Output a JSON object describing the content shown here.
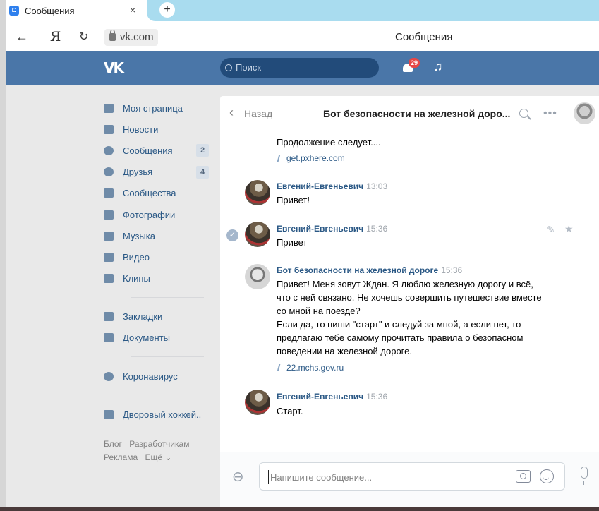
{
  "browser": {
    "tab_title": "Сообщения",
    "tab_close": "×",
    "new_tab": "+",
    "nav_back": "←",
    "nav_ya": "Я",
    "nav_reload": "↻",
    "url": "vk.com",
    "page_title": "Сообщения"
  },
  "vk_header": {
    "logo": "VK",
    "search_placeholder": "Поиск",
    "notifications_count": "29",
    "music_icon": "♫"
  },
  "sidebar": {
    "items": [
      {
        "label": "Моя страница",
        "icon": "home-icon",
        "count": ""
      },
      {
        "label": "Новости",
        "icon": "news-icon",
        "count": ""
      },
      {
        "label": "Сообщения",
        "icon": "messages-icon",
        "count": "2"
      },
      {
        "label": "Друзья",
        "icon": "friends-icon",
        "count": "4"
      },
      {
        "label": "Сообщества",
        "icon": "communities-icon",
        "count": ""
      },
      {
        "label": "Фотографии",
        "icon": "photos-icon",
        "count": ""
      },
      {
        "label": "Музыка",
        "icon": "music-icon",
        "count": ""
      },
      {
        "label": "Видео",
        "icon": "video-icon",
        "count": ""
      },
      {
        "label": "Клипы",
        "icon": "clips-icon",
        "count": ""
      },
      {
        "label": "Закладки",
        "icon": "bookmarks-icon",
        "count": ""
      },
      {
        "label": "Документы",
        "icon": "documents-icon",
        "count": ""
      },
      {
        "label": "Коронавирус",
        "icon": "coronavirus-icon",
        "count": ""
      },
      {
        "label": "Дворовый хоккей..",
        "icon": "group-icon",
        "count": ""
      }
    ],
    "footer": [
      "Блог",
      "Разработчикам",
      "Реклама",
      "Ещё ⌄"
    ]
  },
  "chat": {
    "back_label": "Назад",
    "back_chevron": "‹",
    "title": "Бот безопасности на железной доро...",
    "more": "•••",
    "messages": [
      {
        "text": "Продолжение следует....",
        "link": "get.pxhere.com"
      },
      {
        "author": "Евгений-Евгеньевич",
        "time": "13:03",
        "text": "Привет!"
      },
      {
        "author": "Евгений-Евгеньевич",
        "time": "15:36",
        "text": "Привет"
      },
      {
        "author": "Бот безопасности на железной дороге",
        "time": "15:36",
        "lines": [
          "Привет! Меня зовут Ждан. Я люблю железную дорогу и всё,",
          "что с ней связано. Не хочешь совершить путешествие вместе",
          "со мной на поезде?",
          "Если да, то пиши \"старт\" и следуй за мной, а если нет, то",
          "предлагаю тебе самому прочитать правила о безопасном",
          "поведении на железной дороге."
        ],
        "link": "22.mchs.gov.ru"
      },
      {
        "author": "Евгений-Евгеньевич",
        "time": "15:36",
        "text": "Старт."
      }
    ],
    "composer_placeholder": "Напишите сообщение..."
  }
}
